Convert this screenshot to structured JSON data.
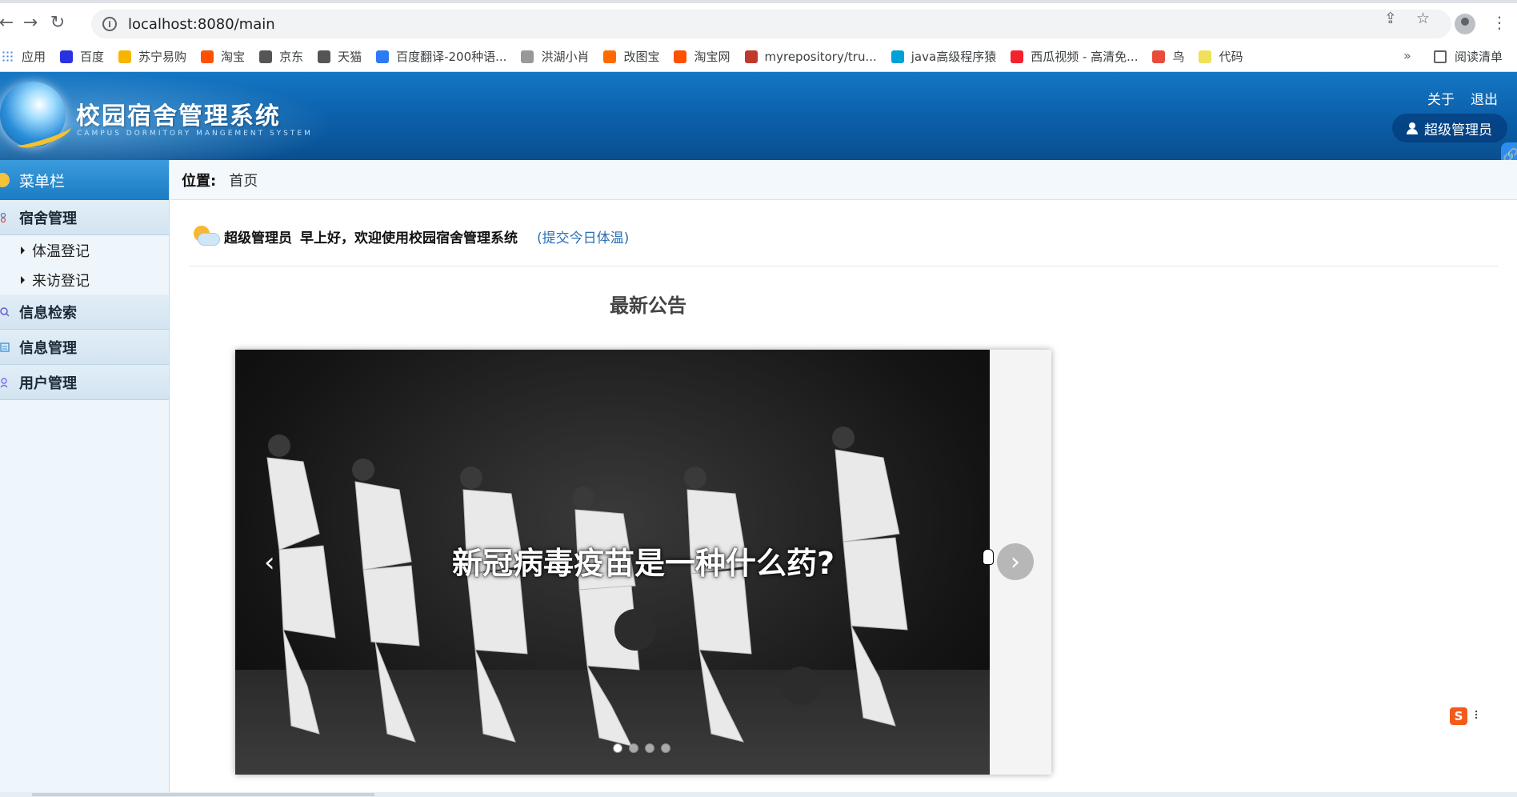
{
  "browser": {
    "url": "localhost:8080/main",
    "bookmarks": [
      {
        "label": "应用",
        "color": "#4285f4"
      },
      {
        "label": "百度",
        "color": "#2932e1"
      },
      {
        "label": "苏宁易购",
        "color": "#f7b500"
      },
      {
        "label": "淘宝",
        "color": "#ff5000"
      },
      {
        "label": "京东",
        "color": "#555555"
      },
      {
        "label": "天猫",
        "color": "#555555"
      },
      {
        "label": "百度翻译-200种语...",
        "color": "#2d7bf4"
      },
      {
        "label": "洪湖小肖",
        "color": "#999999"
      },
      {
        "label": "改图宝",
        "color": "#ff6a00"
      },
      {
        "label": "淘宝网",
        "color": "#ff5000"
      },
      {
        "label": "myrepository/tru...",
        "color": "#c0392b"
      },
      {
        "label": "java高级程序猿",
        "color": "#00a1d6"
      },
      {
        "label": "西瓜视频 - 高清免...",
        "color": "#f5222d"
      },
      {
        "label": "鸟",
        "color": "#e74c3c"
      },
      {
        "label": "代码",
        "color": "#f1e05a"
      }
    ],
    "more": "»",
    "reading_list": "阅读清单"
  },
  "header": {
    "title": "校园宿舍管理系统",
    "subtitle": "CAMPUS DORMITORY MANGEMENT SYSTEM",
    "about": "关于",
    "logout": "退出",
    "user": "超级管理员"
  },
  "sidebar": {
    "title": "菜单栏",
    "sections": [
      {
        "label": "宿舍管理",
        "icon": "dorm-icon",
        "items": [
          "体温登记",
          "来访登记"
        ]
      },
      {
        "label": "信息检索",
        "icon": "search-icon",
        "items": []
      },
      {
        "label": "信息管理",
        "icon": "list-icon",
        "items": []
      },
      {
        "label": "用户管理",
        "icon": "user-icon",
        "items": []
      }
    ]
  },
  "main": {
    "breadcrumb_label": "位置:",
    "breadcrumb_value": "首页",
    "welcome_user": "超级管理员",
    "welcome_msg": "早上好，欢迎使用校园宿舍管理系统",
    "submit_link": "(提交今日体温)",
    "notice_title": "最新公告",
    "carousel": {
      "caption": "新冠病毒疫苗是一种什么药?",
      "prev": "‹",
      "next": "›",
      "dots": 4,
      "active_dot": 0
    }
  },
  "ime": {
    "label": "S",
    "kb": "⠇"
  }
}
